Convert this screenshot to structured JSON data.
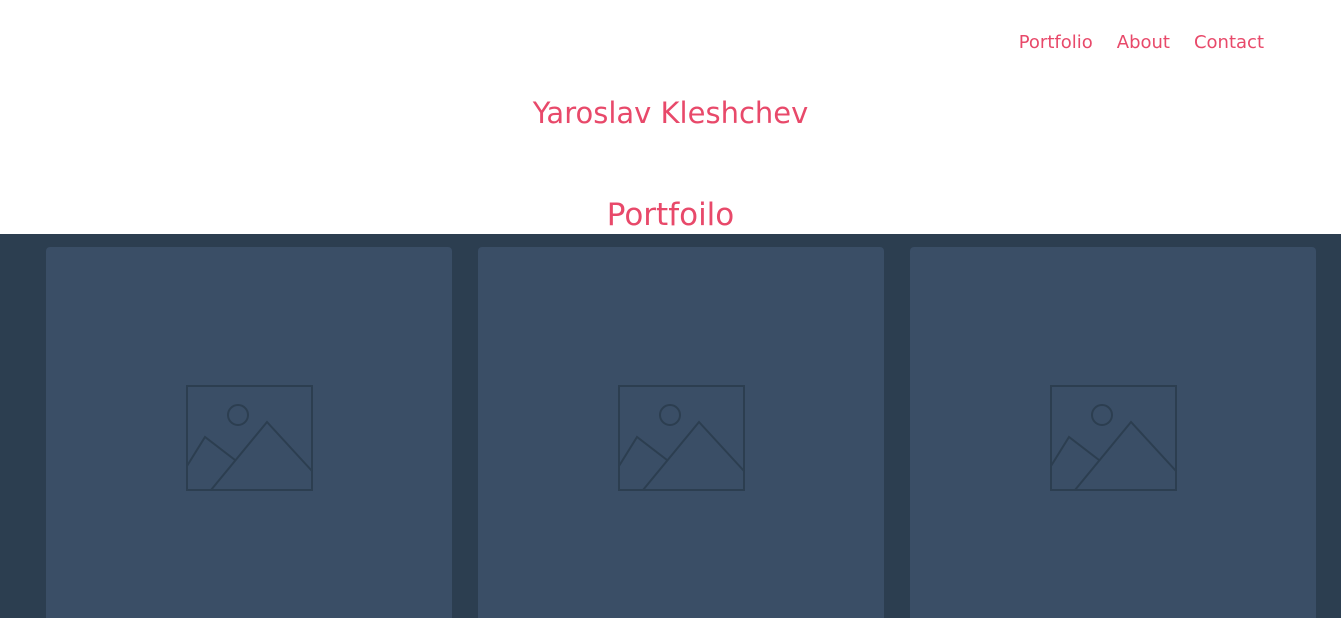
{
  "nav": {
    "items": [
      {
        "label": "Portfolio"
      },
      {
        "label": "About"
      },
      {
        "label": "Contact"
      }
    ]
  },
  "header": {
    "title": "Yaroslav Kleshchev"
  },
  "portfolio": {
    "heading": "Portfoilo",
    "cards": [
      {
        "icon": "image-placeholder-icon"
      },
      {
        "icon": "image-placeholder-icon"
      },
      {
        "icon": "image-placeholder-icon"
      }
    ]
  },
  "colors": {
    "accent": "#e8496a",
    "band_background": "#2c3e50",
    "card_background": "#3a4e66",
    "icon_stroke": "#2c3e50"
  }
}
